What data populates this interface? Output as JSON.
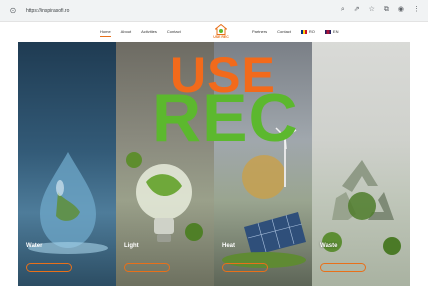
{
  "browser": {
    "url": "https://inspirasofi.ro",
    "icons": [
      "search-icon",
      "share-icon",
      "star-icon",
      "extension-icon",
      "profile-icon",
      "menu-icon"
    ]
  },
  "nav": {
    "left": [
      {
        "label": "Home",
        "active": true
      },
      {
        "label": "About"
      },
      {
        "label": "Activities"
      },
      {
        "label": "Contact"
      }
    ],
    "right": [
      {
        "label": "Partners"
      },
      {
        "label": "Contact"
      },
      {
        "label": "RO"
      },
      {
        "label": "EN"
      }
    ],
    "logo_text": "USE REC"
  },
  "hero": {
    "word1": "USE",
    "word2": "REC",
    "tagline": "",
    "colors": {
      "use": "#f26a1b",
      "rec": "#5cb82e",
      "accent": "#e8701a"
    },
    "panels": [
      {
        "label": "Water",
        "button": ""
      },
      {
        "label": "Light",
        "button": ""
      },
      {
        "label": "Heat",
        "button": ""
      },
      {
        "label": "Waste",
        "button": ""
      }
    ]
  }
}
